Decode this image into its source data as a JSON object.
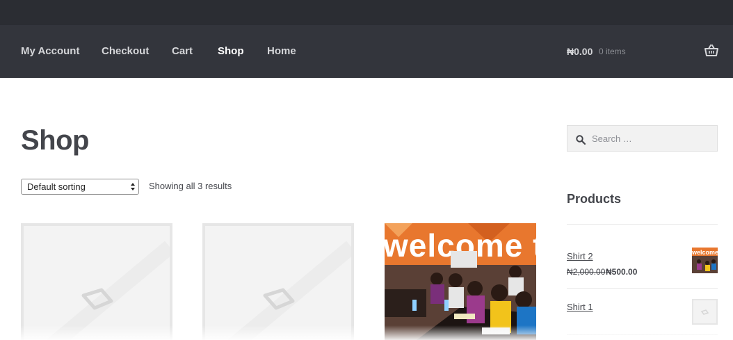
{
  "nav": {
    "items": [
      {
        "label": "My Account"
      },
      {
        "label": "Checkout"
      },
      {
        "label": "Cart"
      },
      {
        "label": "Shop"
      },
      {
        "label": "Home"
      }
    ],
    "active": "Shop"
  },
  "cart": {
    "total": "₦0.00",
    "count": "0 items",
    "icon": "basket-icon"
  },
  "page": {
    "title": "Shop"
  },
  "toolbar": {
    "sort_selected": "Default sorting",
    "result_count": "Showing all 3 results"
  },
  "products": [
    {
      "image": "placeholder"
    },
    {
      "image": "placeholder"
    },
    {
      "image": "photo",
      "banner_text": "welcome t"
    }
  ],
  "sidebar": {
    "search": {
      "placeholder": "Search …",
      "icon": "search-icon"
    },
    "widget_title": "Products",
    "items": [
      {
        "name": "Shirt 2",
        "old_price": "₦2,000.00",
        "new_price": "₦500.00",
        "thumb": "photo",
        "thumb_text": "welcome t"
      },
      {
        "name": "Shirt 1",
        "thumb": "placeholder"
      }
    ]
  },
  "colors": {
    "header_bg": "#33353c",
    "topbar_bg": "#2b2d33",
    "banner_orange": "#e8772e",
    "text": "#43454b"
  }
}
